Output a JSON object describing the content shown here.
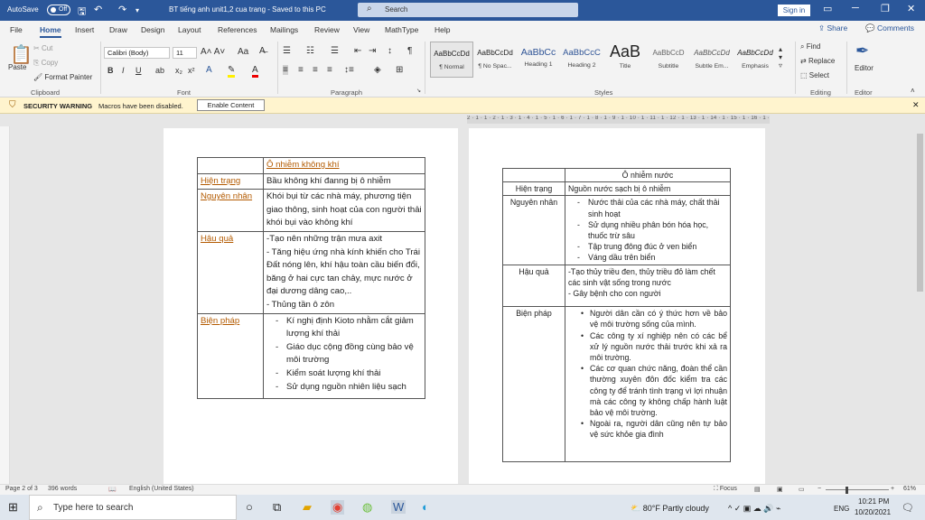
{
  "titlebar": {
    "autosave": "AutoSave",
    "autosave_state": "Off",
    "doc_title": "BT tiếng anh unit1,2 cua trang - Saved to this PC",
    "search_placeholder": "Search",
    "signin": "Sign in"
  },
  "menu": [
    "File",
    "Home",
    "Insert",
    "Draw",
    "Design",
    "Layout",
    "References",
    "Mailings",
    "Review",
    "View",
    "MathType",
    "Help"
  ],
  "share": "Share",
  "comments": "Comments",
  "ribbon": {
    "clipboard": {
      "paste": "Paste",
      "cut": "Cut",
      "copy": "Copy",
      "format_painter": "Format Painter",
      "group": "Clipboard"
    },
    "font": {
      "name": "Calibri (Body)",
      "size": "11",
      "group": "Font"
    },
    "paragraph_group": "Paragraph",
    "styles": [
      {
        "preview": "AaBbCcDd",
        "name": "¶ Normal"
      },
      {
        "preview": "AaBbCcDd",
        "name": "¶ No Spac..."
      },
      {
        "preview": "AaBbCc",
        "name": "Heading 1"
      },
      {
        "preview": "AaBbCcC",
        "name": "Heading 2"
      },
      {
        "preview": "AaB",
        "name": "Title"
      },
      {
        "preview": "AaBbCcD",
        "name": "Subtitle"
      },
      {
        "preview": "AaBbCcDd",
        "name": "Subtle Em..."
      },
      {
        "preview": "AaBbCcDd",
        "name": "Emphasis"
      }
    ],
    "styles_group": "Styles",
    "editing": {
      "find": "Find",
      "replace": "Replace",
      "select": "Select",
      "group": "Editing"
    },
    "editor": {
      "label": "Editor",
      "group": "Editor"
    }
  },
  "security": {
    "title": "SECURITY WARNING",
    "message": "Macros have been disabled.",
    "button": "Enable Content"
  },
  "ruler": "2 · 1 · 1 · 2 · 1 · 3 · 1 · 4 · 1 · 5 · 1 · 6 · 1 · 7 · 1 · 8 · 1 · 9 · 1 · 10 · 1 · 11 · 1 · 12 · 1 · 13 · 1 · 14 · 1 · 15 · 1 · 16 · 1 · 17 · 1 · 18 · 1 · 19",
  "table1": {
    "header": "Ô nhiễm không khí",
    "rows": [
      {
        "label": "Hiện trạng",
        "lines": [
          "Bầu không khí đanng bị ô nhiễm"
        ]
      },
      {
        "label": "Nguyên nhân",
        "lines": [
          "Khói bụi từ các nhà máy, phương tiện giao thông, sinh hoạt của con người thải khói bụi vào không khí"
        ]
      },
      {
        "label": "Hậu quả",
        "lines": [
          "-Tạo nên những trận mưa axit",
          "- Tăng hiệu ứng nhà kính khiến cho Trái Đất nóng lên, khí hậu toàn cầu biến đổi, băng ở hai cực tan chảy, mực nước ở đại dương dâng cao,..",
          "- Thủng tần ô zôn"
        ]
      },
      {
        "label": "Biện pháp",
        "items": [
          "Kí nghị định Kioto nhằm cắt giảm lượng khí thải",
          "Giáo dục cộng đồng cùng bảo vệ môi trường",
          "Kiểm soát lượng khí thải",
          "Sử dụng nguồn nhiên liệu sạch"
        ]
      }
    ]
  },
  "table2": {
    "header": "Ô nhiễm nước",
    "rows": [
      {
        "label": "Hiện trạng",
        "lines": [
          "Nguồn nước sạch bị ô nhiễm"
        ]
      },
      {
        "label": "Nguyên nhân",
        "items": [
          "Nước thải của các nhà máy, chất thải sinh hoạt",
          "Sử dụng nhiều phân bón hóa học, thuốc trừ sâu",
          "Tập trung đông đúc ở ven biển",
          "Váng dầu trên biển"
        ]
      },
      {
        "label": "Hậu quả",
        "lines": [
          "-Tạo thủy triều đen, thủy triều đỏ làm chết các sinh vật sống trong nước",
          "- Gây bệnh cho con người"
        ]
      },
      {
        "label": "Biện pháp",
        "bullets": [
          "Người dân cần có ý thức hơn về bảo vệ môi trường sống của mình.",
          "Các công ty xí nghiệp nên có các bể xử lý nguồn nước thải trước khi xả ra môi trường.",
          "Các cơ quan chức năng, đoàn thể cần thường xuyên đôn đốc kiểm tra các công ty để tránh tình trạng vì lợi nhuận mà các công ty không chấp hành luật bảo vệ môi trường.",
          "Ngoài ra, người dân cũng nên tự bảo vệ sức khỏe gia đình"
        ]
      }
    ]
  },
  "status": {
    "page": "Page 2 of 3",
    "words": "396 words",
    "language": "English (United States)",
    "focus": "Focus",
    "zoom": "61%"
  },
  "taskbar": {
    "search_placeholder": "Type here to search",
    "weather": "80°F Partly cloudy",
    "lang": "ENG",
    "time": "10:21 PM",
    "date": "10/20/2021"
  },
  "colors": {
    "word_blue": "#2b579a",
    "security_bg": "#fff4ce",
    "header_orange": "#b35a00"
  }
}
